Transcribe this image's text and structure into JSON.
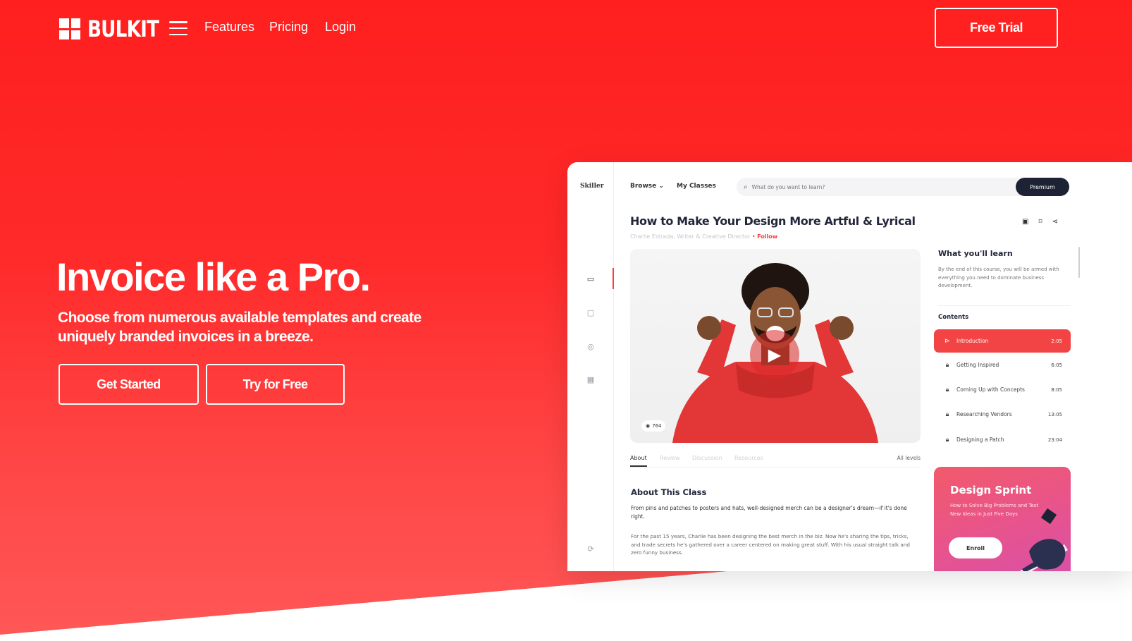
{
  "brand": {
    "name": "BULKIT"
  },
  "nav": {
    "links": [
      "Features",
      "Pricing",
      "Login"
    ],
    "cta": "Free Trial"
  },
  "hero": {
    "title": "Invoice like a Pro.",
    "subtitle": "Choose from numerous available templates and create uniquely branded invoices in a breeze.",
    "buttons": [
      "Get Started",
      "Try for Free"
    ]
  },
  "colors": {
    "primary": "#ff2a2a",
    "accent_dark": "#1e2235"
  },
  "mockup": {
    "brand": "Skiller",
    "nav": {
      "browse": "Browse ⌄",
      "my_classes": "My Classes"
    },
    "search_placeholder": "What do you want to learn?",
    "premium": "Premium",
    "course_title": "How to Make Your Design More Artful & Lyrical",
    "author": "Charlie Estrada, Writer & Creative Director",
    "follow": "Follow",
    "views": "764",
    "tabs": [
      "About",
      "Review",
      "Discussion",
      "Resources"
    ],
    "levels": "All levels",
    "about_title": "About This Class",
    "about_lead": "From pins and patches to posters and hats, well-designed merch can be a designer's dream—if it's done right.",
    "about_body": "For the past 15 years, Charlie has been designing the best merch in the biz. Now he's sharing the tips, tricks, and trade secrets he's gathered over a career centered on making great stuff. With his usual straight talk and zero funny business.",
    "learn_title": "What you'll learn",
    "learn_text": "By the end of this course, you will be armed with everything you need to dominate business development.",
    "contents_title": "Contents",
    "lessons": [
      {
        "name": "Introduction",
        "time": "2:05",
        "icon": "play-icon",
        "active": true
      },
      {
        "name": "Getting Inspired",
        "time": "6:05",
        "icon": "lock-icon",
        "active": false
      },
      {
        "name": "Coming Up with Concepts",
        "time": "8:05",
        "icon": "lock-icon",
        "active": false
      },
      {
        "name": "Researching Vendors",
        "time": "13:05",
        "icon": "lock-icon",
        "active": false
      },
      {
        "name": "Designing a Patch",
        "time": "23:04",
        "icon": "lock-icon",
        "active": false
      }
    ],
    "promo": {
      "title": "Design Sprint",
      "text": "How to Solve Big Problems and Test New Ideas in Just Five Days",
      "button": "Enroll"
    }
  }
}
